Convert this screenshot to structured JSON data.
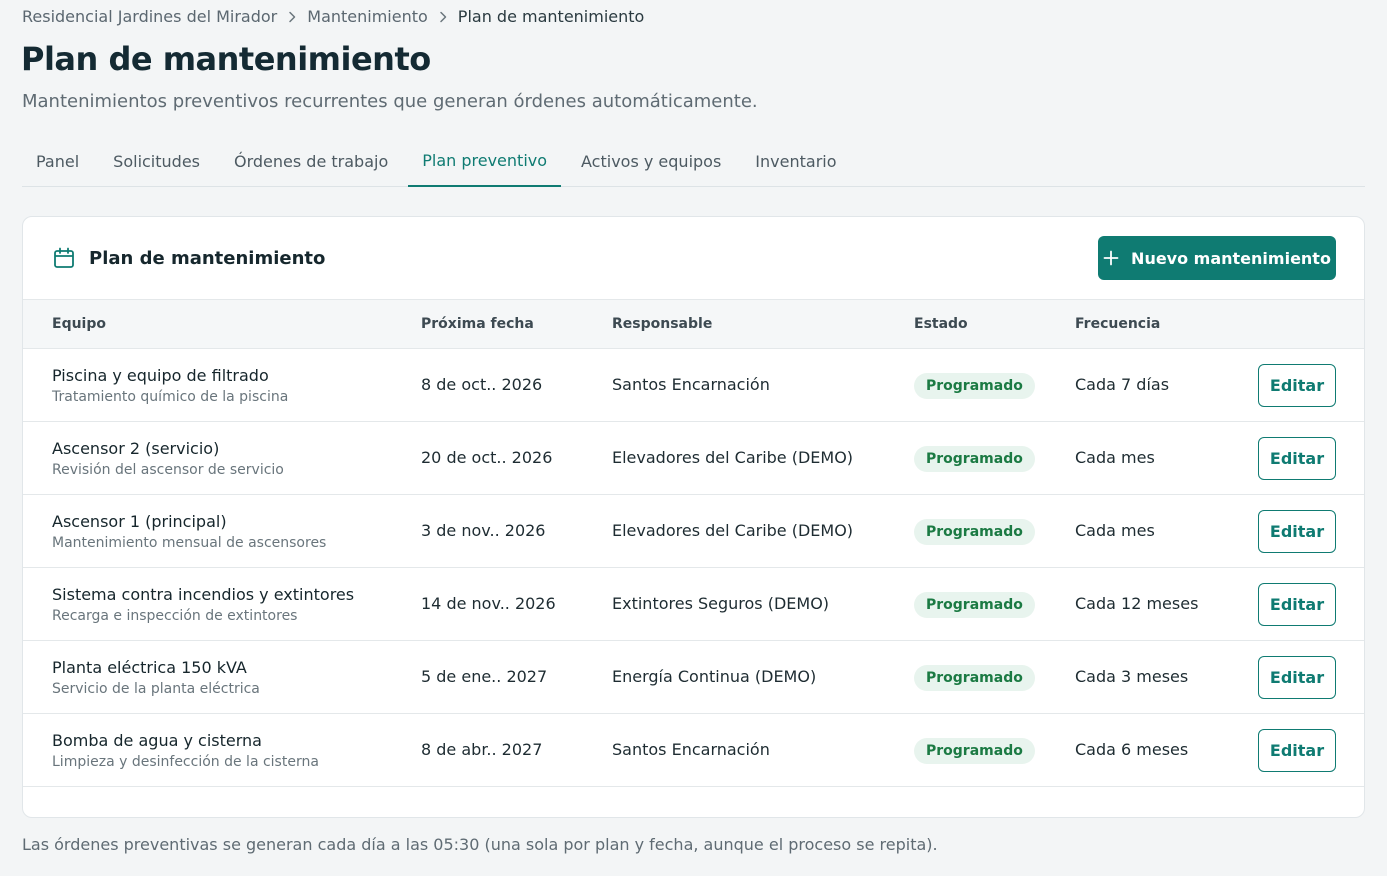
{
  "breadcrumb": {
    "items": [
      "Residencial Jardines del Mirador",
      "Mantenimiento",
      "Plan de mantenimiento"
    ]
  },
  "header": {
    "title": "Plan de mantenimiento",
    "subtitle": "Mantenimientos preventivos recurrentes que generan órdenes automáticamente."
  },
  "tabs": [
    {
      "label": "Panel",
      "active": false
    },
    {
      "label": "Solicitudes",
      "active": false
    },
    {
      "label": "Órdenes de trabajo",
      "active": false
    },
    {
      "label": "Plan preventivo",
      "active": true
    },
    {
      "label": "Activos y equipos",
      "active": false
    },
    {
      "label": "Inventario",
      "active": false
    }
  ],
  "card": {
    "icon": "calendar-icon",
    "title": "Plan de mantenimiento",
    "new_button_label": "Nuevo mantenimiento"
  },
  "table": {
    "columns": [
      "Equipo",
      "Próxima fecha",
      "Responsable",
      "Estado",
      "Frecuencia"
    ],
    "edit_label": "Editar",
    "rows": [
      {
        "equipment": "Piscina y equipo de filtrado",
        "description": "Tratamiento químico de la piscina",
        "next_date": "8 de oct.. 2026",
        "responsible": "Santos Encarnación",
        "status": "Programado",
        "frequency": "Cada 7 días"
      },
      {
        "equipment": "Ascensor 2 (servicio)",
        "description": "Revisión del ascensor de servicio",
        "next_date": "20 de oct.. 2026",
        "responsible": "Elevadores del Caribe (DEMO)",
        "status": "Programado",
        "frequency": "Cada mes"
      },
      {
        "equipment": "Ascensor 1 (principal)",
        "description": "Mantenimiento mensual de ascensores",
        "next_date": "3 de nov.. 2026",
        "responsible": "Elevadores del Caribe (DEMO)",
        "status": "Programado",
        "frequency": "Cada mes"
      },
      {
        "equipment": "Sistema contra incendios y extintores",
        "description": "Recarga e inspección de extintores",
        "next_date": "14 de nov.. 2026",
        "responsible": "Extintores Seguros (DEMO)",
        "status": "Programado",
        "frequency": "Cada 12 meses"
      },
      {
        "equipment": "Planta eléctrica 150 kVA",
        "description": "Servicio de la planta eléctrica",
        "next_date": "5 de ene.. 2027",
        "responsible": "Energía Continua (DEMO)",
        "status": "Programado",
        "frequency": "Cada 3 meses"
      },
      {
        "equipment": "Bomba de agua y cisterna",
        "description": "Limpieza y desinfección de la cisterna",
        "next_date": "8 de abr.. 2027",
        "responsible": "Santos Encarnación",
        "status": "Programado",
        "frequency": "Cada 6 meses"
      }
    ]
  },
  "footnote": "Las órdenes preventivas se generan cada día a las 05:30 (una sola por plan y fecha, aunque el proceso se repita).",
  "colors": {
    "accent": "#0f7b72",
    "status_bg": "#e8f4ee",
    "status_text": "#1b7a43",
    "page_bg": "#f3f5f6"
  }
}
